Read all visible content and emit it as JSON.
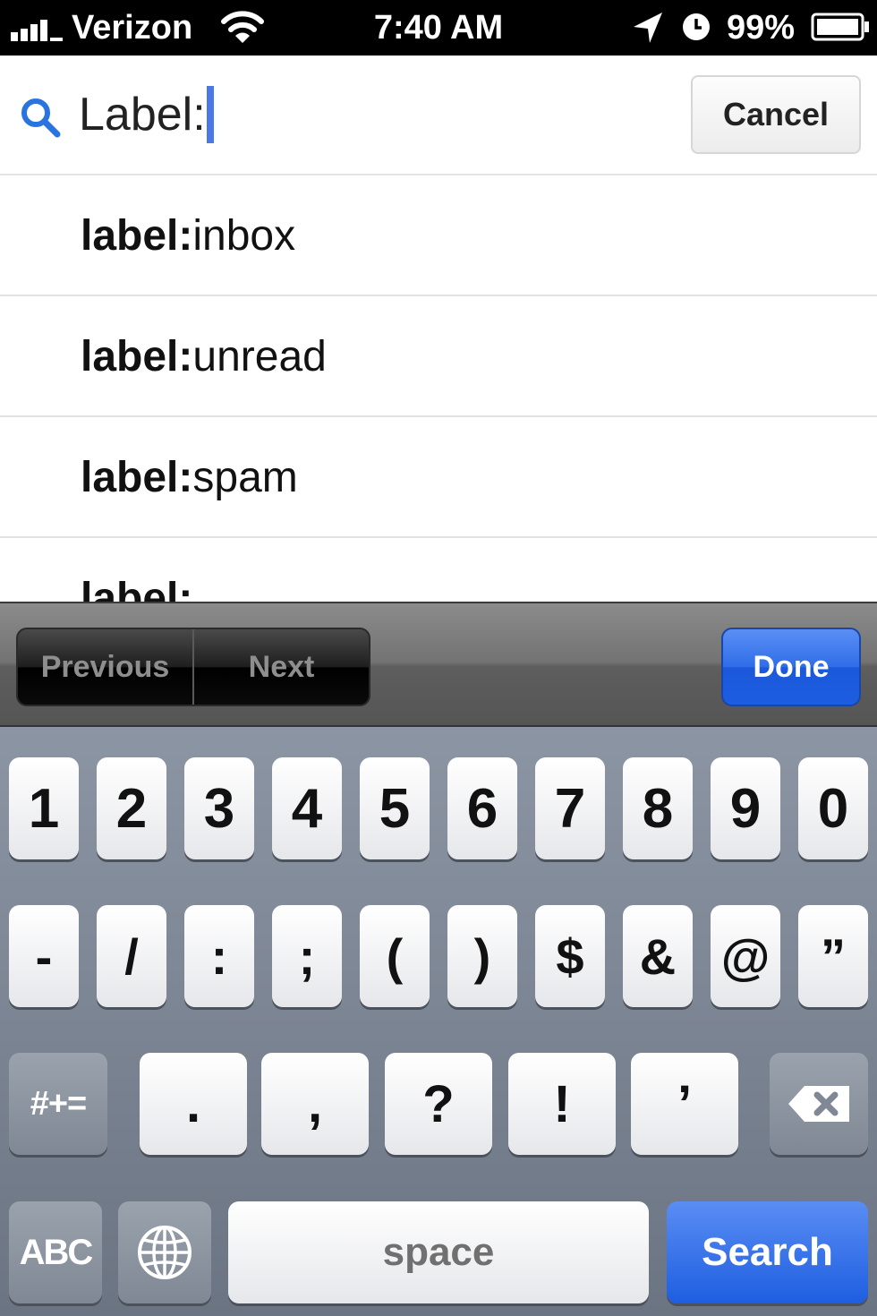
{
  "status_bar": {
    "carrier": "Verizon",
    "time": "7:40 AM",
    "battery_percent": "99%",
    "icons": [
      "signal-bars-icon",
      "wifi-icon",
      "location-arrow-icon",
      "alarm-clock-icon",
      "battery-icon"
    ]
  },
  "search": {
    "value": "Label:",
    "icon": "search-icon",
    "cancel_label": "Cancel"
  },
  "suggestions": [
    {
      "prefix": "label:",
      "value": "inbox"
    },
    {
      "prefix": "label:",
      "value": "unread"
    },
    {
      "prefix": "label:",
      "value": "spam"
    },
    {
      "prefix": "label:",
      "value": ""
    }
  ],
  "form_toolbar": {
    "previous_label": "Previous",
    "next_label": "Next",
    "done_label": "Done"
  },
  "keyboard": {
    "row1": [
      "1",
      "2",
      "3",
      "4",
      "5",
      "6",
      "7",
      "8",
      "9",
      "0"
    ],
    "row2": [
      "-",
      "/",
      ":",
      ";",
      "(",
      ")",
      "$",
      "&",
      "@",
      "”"
    ],
    "row3": {
      "more_symbols_label": "#+=",
      "keys": [
        ".",
        ",",
        "?",
        "!",
        "’"
      ],
      "backspace_icon": "backspace-icon"
    },
    "row4": {
      "abc_label": "ABC",
      "globe_icon": "globe-icon",
      "space_label": "space",
      "search_label": "Search"
    }
  },
  "colors": {
    "accent_blue": "#1e5ee0",
    "caret": "#4a78e6",
    "keyboard_bg": "#7d8694"
  }
}
